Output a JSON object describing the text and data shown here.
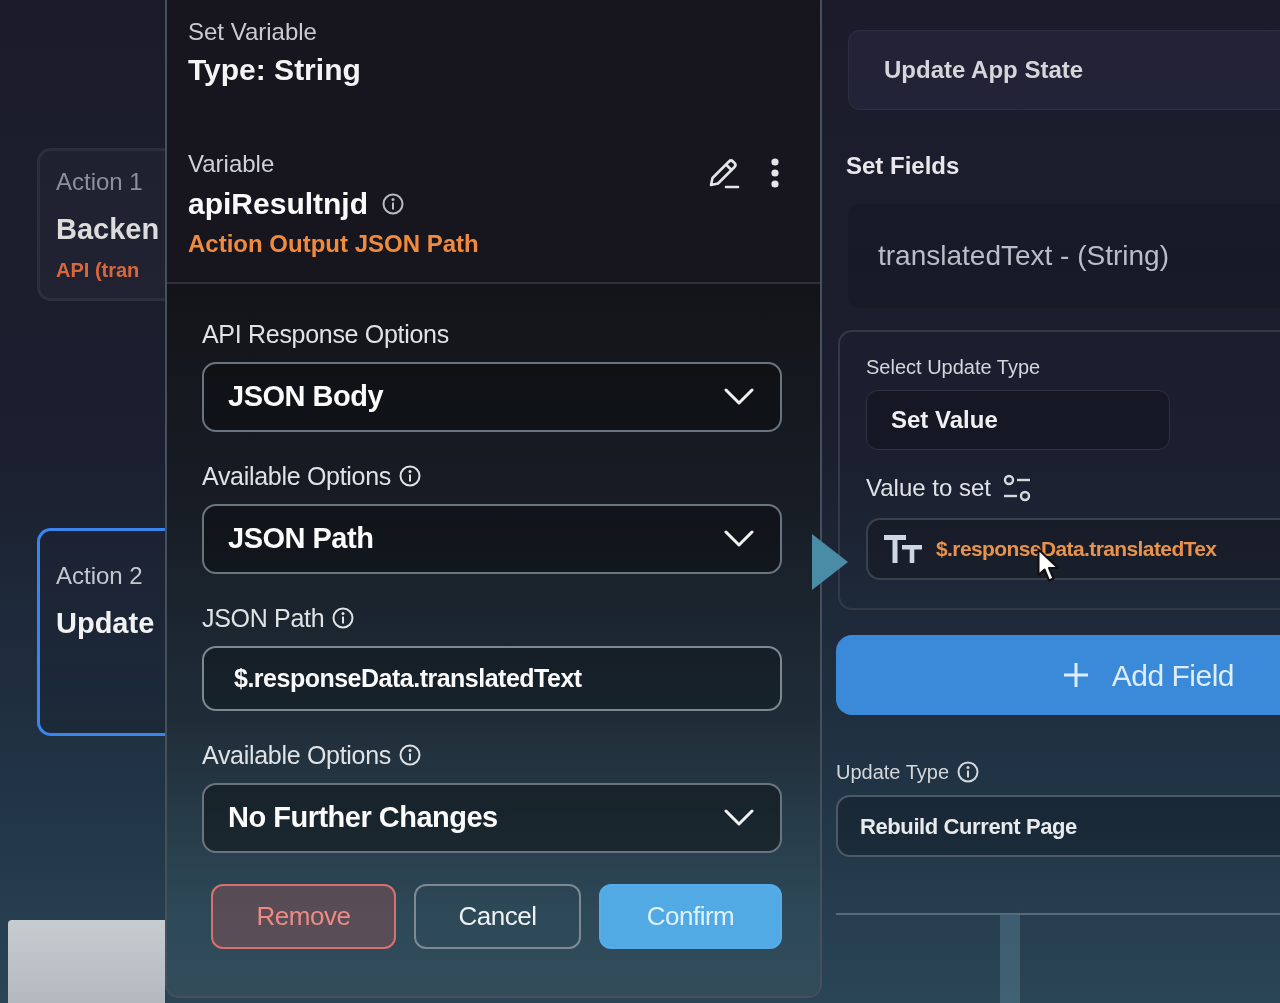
{
  "canvas": {
    "actions": [
      {
        "label": "Action 1",
        "title": "Backen",
        "subtitle": "API (tran",
        "selected": false
      },
      {
        "label": "Action 2",
        "title": "Update",
        "selected": true
      }
    ]
  },
  "dialog": {
    "subtitle": "Set Variable",
    "title": "Type: String",
    "variable": {
      "label": "Variable",
      "name": "apiResultnjd",
      "info": true,
      "source": "Action Output JSON Path"
    },
    "fields": [
      {
        "kind": "dropdown",
        "label": "API Response Options",
        "info": false,
        "value": "JSON Body"
      },
      {
        "kind": "dropdown",
        "label": "Available Options",
        "info": true,
        "value": "JSON Path"
      },
      {
        "kind": "input",
        "label": "JSON Path",
        "info": true,
        "value": "$.responseData.translatedText"
      },
      {
        "kind": "dropdown",
        "label": "Available Options",
        "info": true,
        "value": "No Further Changes"
      }
    ],
    "buttons": [
      {
        "kind": "danger",
        "label": "Remove"
      },
      {
        "kind": "secondary",
        "label": "Cancel"
      },
      {
        "kind": "primary",
        "label": "Confirm"
      }
    ]
  },
  "panel": {
    "title": "Update App State",
    "section": "Set Fields",
    "field": "translatedText - (String)",
    "update_type": {
      "label": "Select Update Type",
      "value": "Set Value"
    },
    "value_to_set": {
      "label": "Value to set",
      "value": "$.responseData.translatedTex"
    },
    "add_button": "Add Field",
    "rebuild": {
      "label": "Update Type",
      "info": true,
      "value": "Rebuild Current Page"
    }
  }
}
